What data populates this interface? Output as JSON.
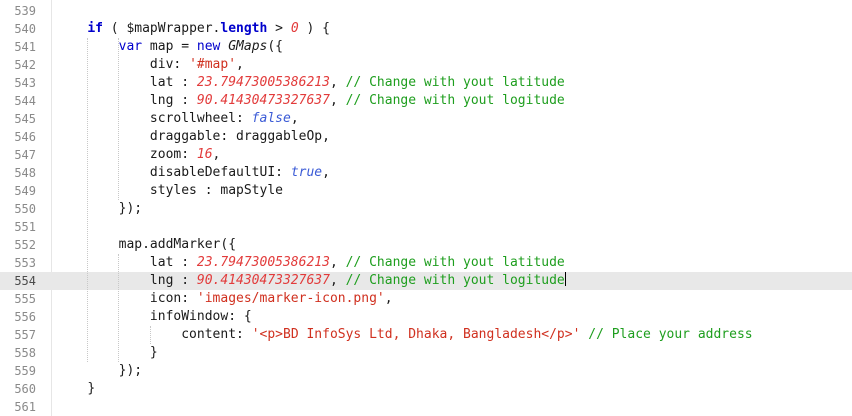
{
  "editor": {
    "lines": [
      {
        "num": "539",
        "indent": "",
        "t": []
      },
      {
        "num": "540",
        "indent": "    ",
        "t": [
          [
            "kw",
            "if"
          ],
          [
            "p",
            " ( "
          ],
          [
            "p",
            "$mapWrapper"
          ],
          [
            "p",
            "."
          ],
          [
            "kw",
            "length"
          ],
          [
            "p",
            " > "
          ],
          [
            "num",
            "0"
          ],
          [
            "p",
            " ) {"
          ]
        ]
      },
      {
        "num": "541",
        "indent": "        ",
        "t": [
          [
            "kw2",
            "var"
          ],
          [
            "p",
            " map = "
          ],
          [
            "kw2",
            "new"
          ],
          [
            "p",
            " "
          ],
          [
            "cls",
            "GMaps"
          ],
          [
            "p",
            "({"
          ]
        ]
      },
      {
        "num": "542",
        "indent": "            ",
        "t": [
          [
            "p",
            "div: "
          ],
          [
            "str",
            "'#map'"
          ],
          [
            "p",
            ","
          ]
        ]
      },
      {
        "num": "543",
        "indent": "            ",
        "t": [
          [
            "p",
            "lat : "
          ],
          [
            "num",
            "23.79473005386213"
          ],
          [
            "p",
            ", "
          ],
          [
            "com",
            "// Change with yout latitude"
          ]
        ]
      },
      {
        "num": "544",
        "indent": "            ",
        "t": [
          [
            "p",
            "lng : "
          ],
          [
            "num",
            "90.41430473327637"
          ],
          [
            "p",
            ", "
          ],
          [
            "com",
            "// Change with yout logitude"
          ]
        ]
      },
      {
        "num": "545",
        "indent": "            ",
        "t": [
          [
            "p",
            "scrollwheel: "
          ],
          [
            "bool",
            "false"
          ],
          [
            "p",
            ","
          ]
        ]
      },
      {
        "num": "546",
        "indent": "            ",
        "t": [
          [
            "p",
            "draggable: draggableOp,"
          ]
        ]
      },
      {
        "num": "547",
        "indent": "            ",
        "t": [
          [
            "p",
            "zoom: "
          ],
          [
            "num",
            "16"
          ],
          [
            "p",
            ","
          ]
        ]
      },
      {
        "num": "548",
        "indent": "            ",
        "t": [
          [
            "p",
            "disableDefaultUI: "
          ],
          [
            "bool",
            "true"
          ],
          [
            "p",
            ","
          ]
        ]
      },
      {
        "num": "549",
        "indent": "            ",
        "t": [
          [
            "p",
            "styles : mapStyle"
          ]
        ]
      },
      {
        "num": "550",
        "indent": "        ",
        "t": [
          [
            "p",
            "});"
          ]
        ]
      },
      {
        "num": "551",
        "indent": "",
        "t": []
      },
      {
        "num": "552",
        "indent": "        ",
        "t": [
          [
            "p",
            "map.addMarker({"
          ]
        ]
      },
      {
        "num": "553",
        "indent": "            ",
        "t": [
          [
            "p",
            "lat : "
          ],
          [
            "num",
            "23.79473005386213"
          ],
          [
            "p",
            ", "
          ],
          [
            "com",
            "// Change with yout latitude"
          ]
        ]
      },
      {
        "num": "554",
        "indent": "            ",
        "t": [
          [
            "p",
            "lng : "
          ],
          [
            "num",
            "90.41430473327637"
          ],
          [
            "p",
            ", "
          ],
          [
            "com",
            "// Change with yout logitude"
          ]
        ],
        "current": true,
        "caret": true
      },
      {
        "num": "555",
        "indent": "            ",
        "t": [
          [
            "p",
            "icon: "
          ],
          [
            "str",
            "'images/marker-icon.png'"
          ],
          [
            "p",
            ","
          ]
        ]
      },
      {
        "num": "556",
        "indent": "            ",
        "t": [
          [
            "p",
            "infoWindow: {"
          ]
        ]
      },
      {
        "num": "557",
        "indent": "                ",
        "t": [
          [
            "p",
            "content: "
          ],
          [
            "str",
            "'<p>BD InfoSys Ltd, Dhaka, Bangladesh</p>'"
          ],
          [
            "p",
            " "
          ],
          [
            "com",
            "// Place your address"
          ]
        ]
      },
      {
        "num": "558",
        "indent": "            ",
        "t": [
          [
            "p",
            "}"
          ]
        ]
      },
      {
        "num": "559",
        "indent": "        ",
        "t": [
          [
            "p",
            "});"
          ]
        ]
      },
      {
        "num": "560",
        "indent": "    ",
        "t": [
          [
            "p",
            "}"
          ]
        ]
      },
      {
        "num": "561",
        "indent": "",
        "t": []
      }
    ]
  }
}
